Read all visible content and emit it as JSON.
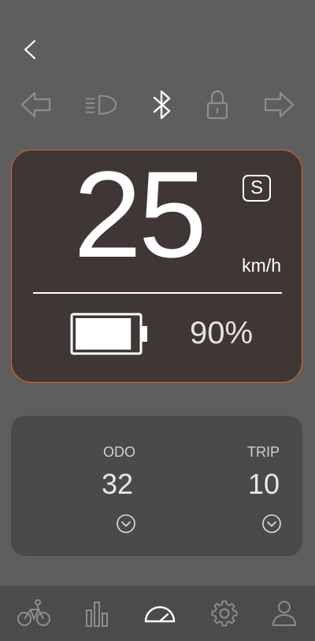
{
  "dashboard": {
    "speed": "25",
    "unit": "km/h",
    "mode": "S",
    "battery_percent_text": "90%",
    "battery_level": 0.9
  },
  "odometer": {
    "label": "ODO",
    "value": "32"
  },
  "trip": {
    "label": "TRIP",
    "value": "10"
  },
  "icons": {
    "back": "chevron-left-icon",
    "status": [
      "arrow-left-icon",
      "headlight-icon",
      "bluetooth-icon",
      "lock-icon",
      "arrow-right-icon"
    ],
    "nav": [
      "bike-icon",
      "bar-chart-icon",
      "speedometer-icon",
      "gear-icon",
      "user-icon"
    ]
  },
  "colors": {
    "accent": "#d9682b",
    "card_bg": "#3f3735",
    "page_bg": "#5e5e5e",
    "active_icon": "#ffffff",
    "inactive_icon": "#8e8e8e"
  }
}
